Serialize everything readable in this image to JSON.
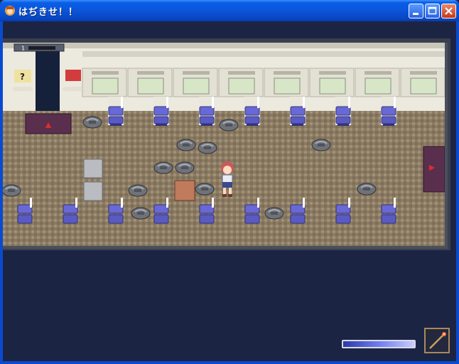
{
  "window": {
    "title": "はぢきせ！！",
    "minimize_icon": "minimize-icon",
    "maximize_icon": "maximize-icon",
    "close_icon": "close-icon"
  },
  "game": {
    "scene": "train-car-interior",
    "door_counter_label": "1",
    "status_bar_level": 1.0,
    "equipped_item_icon": "wand-icon",
    "colors": {
      "floor": "#8a7a62",
      "seat": "#6a6ad8",
      "wall": "#ece9de",
      "hud_bar": "#6f7cf0"
    }
  }
}
